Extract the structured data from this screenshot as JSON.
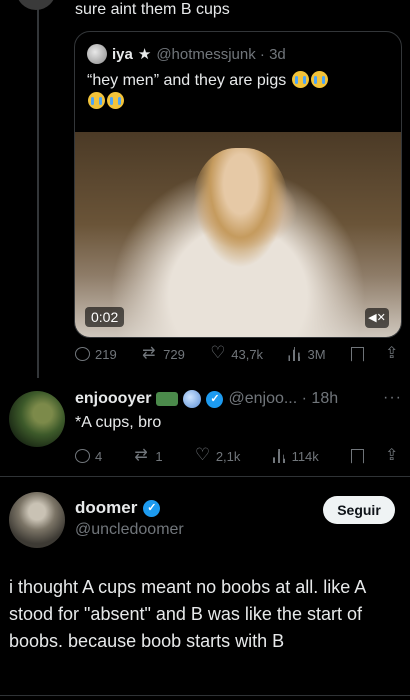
{
  "reply": {
    "text": "sure aint them B cups"
  },
  "quoted": {
    "name": "iya",
    "star": "★",
    "handle_time": "@hotmessjunk · 3d",
    "text": "“hey men” and they are pigs",
    "video_time": "0:02",
    "mute_icon": "mute-icon"
  },
  "reply_actions": {
    "replies": "219",
    "reposts": "729",
    "likes": "43,7k",
    "views": "3M"
  },
  "tweet2": {
    "name": "enjoooyer",
    "handle_time": "@enjoo... · 18h",
    "text": "*A cups, bro",
    "more": "···",
    "actions": {
      "replies": "4",
      "reposts": "1",
      "likes": "2,1k",
      "views": "114k"
    }
  },
  "tweet3": {
    "name": "doomer",
    "handle": "@uncledoomer",
    "follow_label": "Seguir",
    "text": "i thought A cups meant no boobs at all. like A stood for \"absent\" and B was like the start of boobs. because boob starts with B"
  },
  "colors": {
    "background": "#000000",
    "text": "#e7e9ea",
    "muted": "#71767b",
    "verified": "#1d9bf0"
  }
}
